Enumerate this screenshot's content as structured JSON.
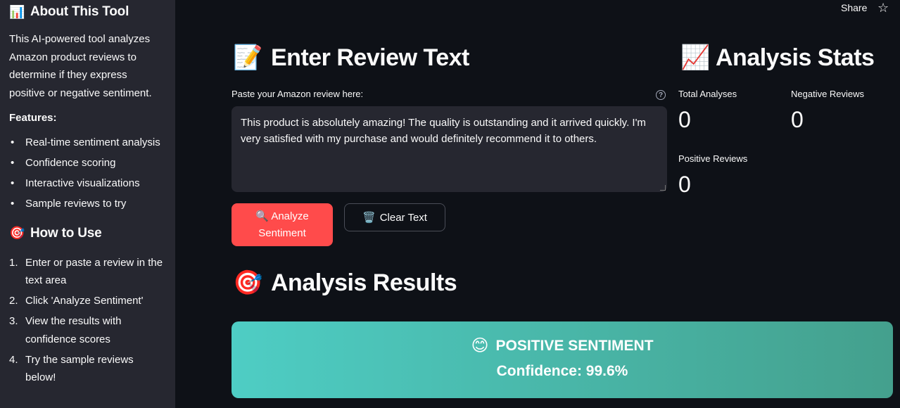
{
  "sidebar": {
    "about": {
      "icon": "bar-chart-icon",
      "emoji": "📊",
      "title": "About This Tool",
      "description": "This AI-powered tool analyzes Amazon product reviews to determine if they express positive or negative sentiment."
    },
    "features": {
      "label": "Features:",
      "items": [
        "Real-time sentiment analysis",
        "Confidence scoring",
        "Interactive visualizations",
        "Sample reviews to try"
      ]
    },
    "how_to_use": {
      "icon": "target-icon",
      "emoji": "🎯",
      "title": "How to Use",
      "steps": [
        {
          "num": "1.",
          "text": "Enter or paste a review in the text area"
        },
        {
          "num": "2.",
          "text": "Click 'Analyze Sentiment'"
        },
        {
          "num": "3.",
          "text": "View the results with confidence scores"
        },
        {
          "num": "4.",
          "text": "Try the sample reviews below!"
        }
      ]
    }
  },
  "toolbar": {
    "share_label": "Share",
    "star_icon": "☆"
  },
  "input_section": {
    "emoji": "📝",
    "title": "Enter Review Text",
    "field_label": "Paste your Amazon review here:",
    "help_glyph": "?",
    "review_text": "This product is absolutely amazing! The quality is outstanding and it arrived quickly. I'm very satisfied with my purchase and would definitely recommend it to others."
  },
  "buttons": {
    "analyze": {
      "emoji": "🔍",
      "label_line1": "Analyze",
      "label_line2": "Sentiment"
    },
    "clear": {
      "emoji": "🗑️",
      "label": "Clear Text"
    }
  },
  "stats": {
    "emoji": "📈",
    "title": "Analysis Stats",
    "total": {
      "label": "Total Analyses",
      "value": "0"
    },
    "negative": {
      "label": "Negative Reviews",
      "value": "0"
    },
    "positive": {
      "label": "Positive Reviews",
      "value": "0"
    }
  },
  "results": {
    "emoji": "🎯",
    "title": "Analysis Results",
    "sentiment_emoji": "😊",
    "sentiment_label": "POSITIVE SENTIMENT",
    "confidence_text": "Confidence: 99.6%",
    "gradient_start": "#4ecdc4",
    "gradient_end": "#44a08d"
  },
  "colors": {
    "background": "#0e1117",
    "sidebar": "#262730",
    "primary_button": "#ff4b4b"
  }
}
